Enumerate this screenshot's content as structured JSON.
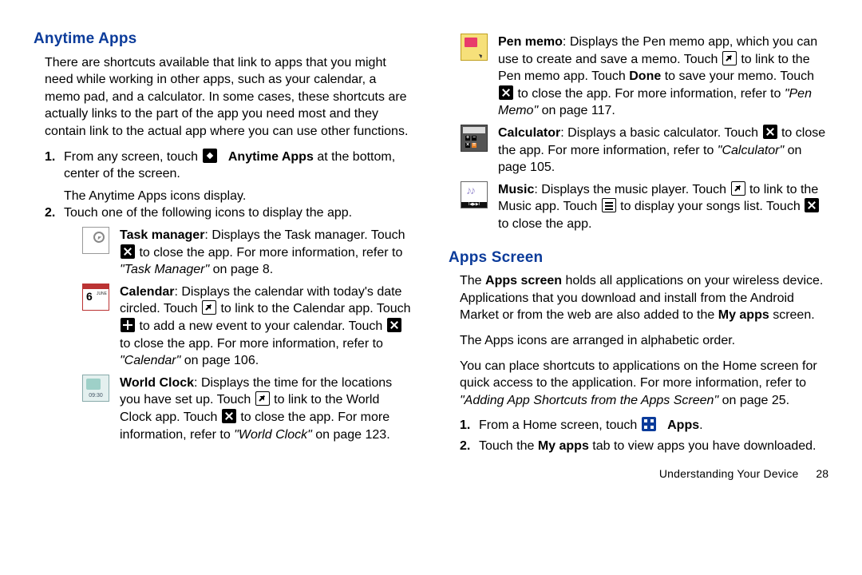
{
  "section1_title": "Anytime Apps",
  "intro": "There are shortcuts available that link to apps that you might need while working in other apps, such as your calendar, a memo pad, and a calculator. In some cases, these shortcuts are actually links to the part of the app you need most and they contain link to the actual app where you can use other functions.",
  "steps1": {
    "s1a": "From any screen, touch ",
    "s1b": " at the bottom, center of the screen.",
    "s1_label": "Anytime Apps",
    "s1_sub": "The Anytime Apps icons display.",
    "s2": "Touch one of the following icons to display the app."
  },
  "task": {
    "pre": ": Displays the Task manager. Touch ",
    "post": " to close the app. For more information, refer to ",
    "ref": "\"Task Manager\"",
    "pg": " on page 8.",
    "name": "Task manager"
  },
  "cal": {
    "a": ": Displays the calendar with today's date circled. Touch ",
    "b": " to link to the Calendar app. Touch ",
    "c": " to add a new event to your calendar. Touch ",
    "d": " to close the app. For more information, refer to ",
    "ref": "\"Calendar\"",
    "pg": " on page 106.",
    "name": "Calendar",
    "day": "6",
    "month": "JUNE"
  },
  "wc": {
    "a": ": Displays the time for the locations you have set up. Touch ",
    "b": " to link to the World Clock app. Touch ",
    "c": " to close the app. For more information, refer to ",
    "ref": "\"World Clock\"",
    "pg": " on page 123.",
    "name": "World Clock",
    "time": "09:30"
  },
  "pm": {
    "a": ": Displays the Pen memo app, which you can use to create and save a memo. Touch ",
    "b": " to link to the Pen memo app. Touch ",
    "done": "Done",
    "c": " to save your memo. Touch ",
    "d": " to close the app. For more information, refer to ",
    "ref": "\"Pen Memo\"",
    "pg": " on page 117.",
    "name": "Pen memo"
  },
  "calc": {
    "a": ": Displays a basic calculator. Touch ",
    "b": " to close the app. For more information, refer to ",
    "ref": "\"Calculator\"",
    "pg": " on page 105.",
    "name": "Calculator"
  },
  "mus": {
    "a": ": Displays the music player. Touch ",
    "b": " to link to the Music app. Touch ",
    "c": " to display your songs list. Touch ",
    "d": " to close the app.",
    "name": "Music"
  },
  "section2_title": "Apps Screen",
  "apps_intro_a": "The ",
  "apps_intro_bold": "Apps screen",
  "apps_intro_b": " holds all applications on your wireless device. Applications that you download and install from the Android Market or from the web are also added to the ",
  "apps_intro_bold2": "My apps",
  "apps_intro_c": " screen.",
  "apps_order": "The Apps icons are arranged in alphabetic order.",
  "apps_shortcuts_a": "You can place shortcuts to applications on the Home screen for quick access to the application. For more information, refer to ",
  "apps_shortcuts_ref": "\"Adding App Shortcuts from the Apps Screen\"",
  "apps_shortcuts_pg": " on page 25.",
  "steps2": {
    "s1a": "From a Home screen, touch ",
    "s1_label": "Apps",
    "s1b": ".",
    "s2a": "Touch the ",
    "s2_bold": "My apps",
    "s2b": " tab to view apps you have downloaded."
  },
  "footer_label": "Understanding Your Device",
  "footer_page": "28"
}
